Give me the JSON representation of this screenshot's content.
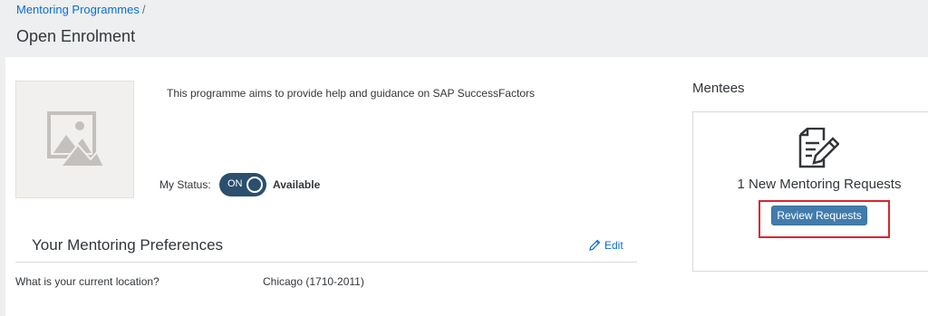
{
  "breadcrumb": {
    "link": "Mentoring Programmes",
    "separator": "/"
  },
  "page": {
    "title": "Open Enrolment"
  },
  "programme": {
    "description": "This programme aims to provide help and guidance on SAP SuccessFactors"
  },
  "status": {
    "label": "My Status:",
    "toggle_text": "ON",
    "toggle_on": true,
    "value": "Available"
  },
  "preferences": {
    "title": "Your Mentoring Preferences",
    "edit_label": "Edit",
    "rows": [
      {
        "question": "What is your current location?",
        "answer": "Chicago (1710-2011)"
      }
    ]
  },
  "mentees": {
    "title": "Mentees",
    "requests_text": "1 New Mentoring Requests",
    "review_button": "Review Requests"
  },
  "colors": {
    "accent": "#0a6ed1",
    "toggle_bg": "#2b4f6e",
    "button_bg": "#427cac",
    "highlight": "#d9262f"
  },
  "icons": [
    "image-placeholder-icon",
    "pencil-icon",
    "document-edit-icon"
  ]
}
